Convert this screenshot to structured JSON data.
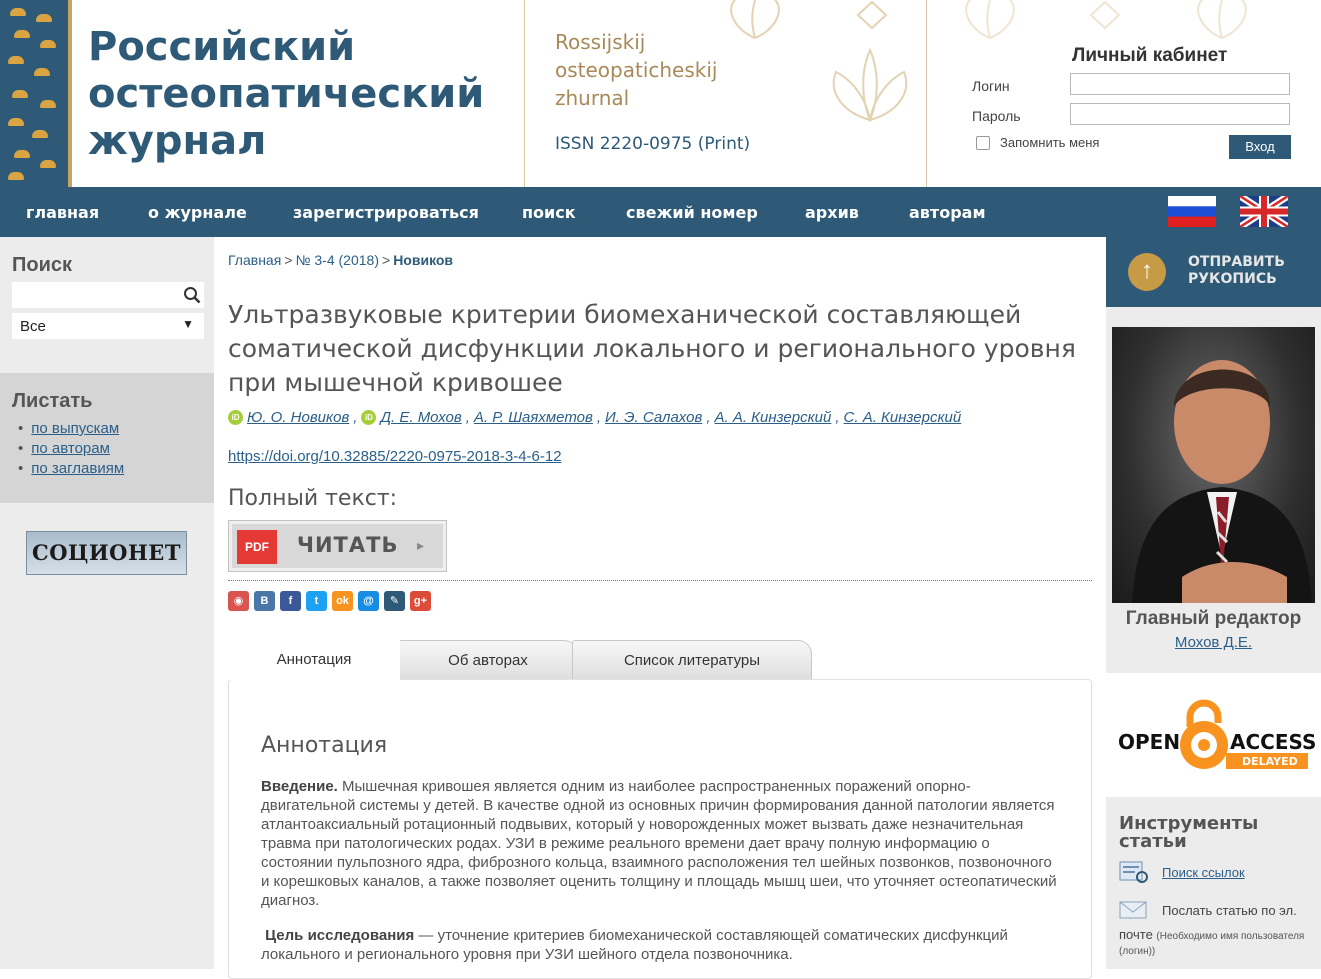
{
  "header": {
    "title_ru": "Российский остеопатический журнал",
    "title_lat_lines": [
      "Rossijskij",
      "osteopaticheskij",
      "zhurnal"
    ],
    "issn": "ISSN 2220-0975 (Print)",
    "cabinet": {
      "title": "Личный кабинет",
      "login_label": "Логин",
      "password_label": "Пароль",
      "remember_label": "Запомнить меня",
      "login_button": "Вход"
    }
  },
  "nav": {
    "items": [
      "главная",
      "о журнале",
      "зарегистрироваться",
      "поиск",
      "свежий номер",
      "архив",
      "авторам"
    ],
    "flags": [
      "russian-flag-icon",
      "uk-flag-icon"
    ]
  },
  "left_sidebar": {
    "search_heading": "Поиск",
    "search_value": "",
    "select_value": "Все",
    "browse_heading": "Листать",
    "browse_links": [
      "по выпускам",
      "по авторам",
      "по заглавиям"
    ],
    "socionet_label": "СОЦИОНЕТ"
  },
  "breadcrumb": {
    "home": "Главная",
    "issue": "№ 3-4 (2018)",
    "current": "Новиков",
    "separator": ">"
  },
  "article": {
    "title": "Ультразвуковые критерии биомеханической составляющей соматической дисфункции локального и регионального уровня при мышечной кривошее",
    "authors": [
      "Ю. О. Новиков",
      "Д. Е. Мохов",
      "А. Р. Шаяхметов",
      "И. Э. Салахов",
      "А. А. Кинзерский",
      "С. А. Кинзерский"
    ],
    "orcid_label": "iD",
    "doi": "https://doi.org/10.32885/2220-0975-2018-3-4-6-12",
    "fulltext_heading": "Полный текст:",
    "pdf_badge": "PDF",
    "read_button": "ЧИТАТЬ",
    "share_icons": [
      "rss-icon",
      "vk-icon",
      "facebook-icon",
      "twitter-icon",
      "odnoklassniki-icon",
      "mail-icon",
      "livejournal-icon",
      "googleplus-icon"
    ],
    "share_glyphs": [
      "◉",
      "B",
      "f",
      "t",
      "ok",
      "@",
      "✎",
      "g+"
    ],
    "share_colors": [
      "#d9534f",
      "#4a76a8",
      "#3b5998",
      "#1da1f2",
      "#f7931e",
      "#168de2",
      "#2e5a78",
      "#dd4b39"
    ],
    "tabs": [
      "Аннотация",
      "Об авторах",
      "Список литературы"
    ],
    "abstract_heading": "Аннотация",
    "intro_label": "Введение.",
    "intro_text": "Мышечная кривошея является одним из наиболее распространенных поражений опорно-двигательной системы у детей. В качестве одной из основных причин формирования данной патологии является атлантоаксиальный ротационный подвывих, который у новорожденных может вызвать даже незначительная травма при патологических родах. УЗИ в режиме реального времени дает врачу полную информацию о состоянии пульпозного ядра, фиброзного кольца, взаимного расположения тел шейных позвонков, позвоночного и корешковых каналов, а также позволяет оценить толщину и площадь мышц шеи, что уточняет остеопатический диагноз.",
    "goal_label": "Цель исследования",
    "goal_text": "— уточнение критериев биомеханической составляющей соматических дисфункций локального и регионального уровня при УЗИ шейного отдела позвоночника."
  },
  "right_sidebar": {
    "submit_lines": [
      "ОТПРАВИТЬ",
      "РУКОПИСЬ"
    ],
    "editor_heading": "Главный редактор",
    "editor_name": "Мохов Д.Е.",
    "oa_open": "OPEN",
    "oa_access": "ACCESS",
    "oa_delayed": "DELAYED",
    "tools_heading": "Инструменты статьи",
    "tool_links": [
      "Поиск ссылок"
    ],
    "email_tool_text": "Послать статью по эл.",
    "email_tool_text2": "почте",
    "email_tool_note": "(Необходимо имя пользователя (логин))"
  },
  "colors": {
    "brand": "#2e5a78",
    "gold": "#c8a36a",
    "link": "#2b5f8a"
  }
}
